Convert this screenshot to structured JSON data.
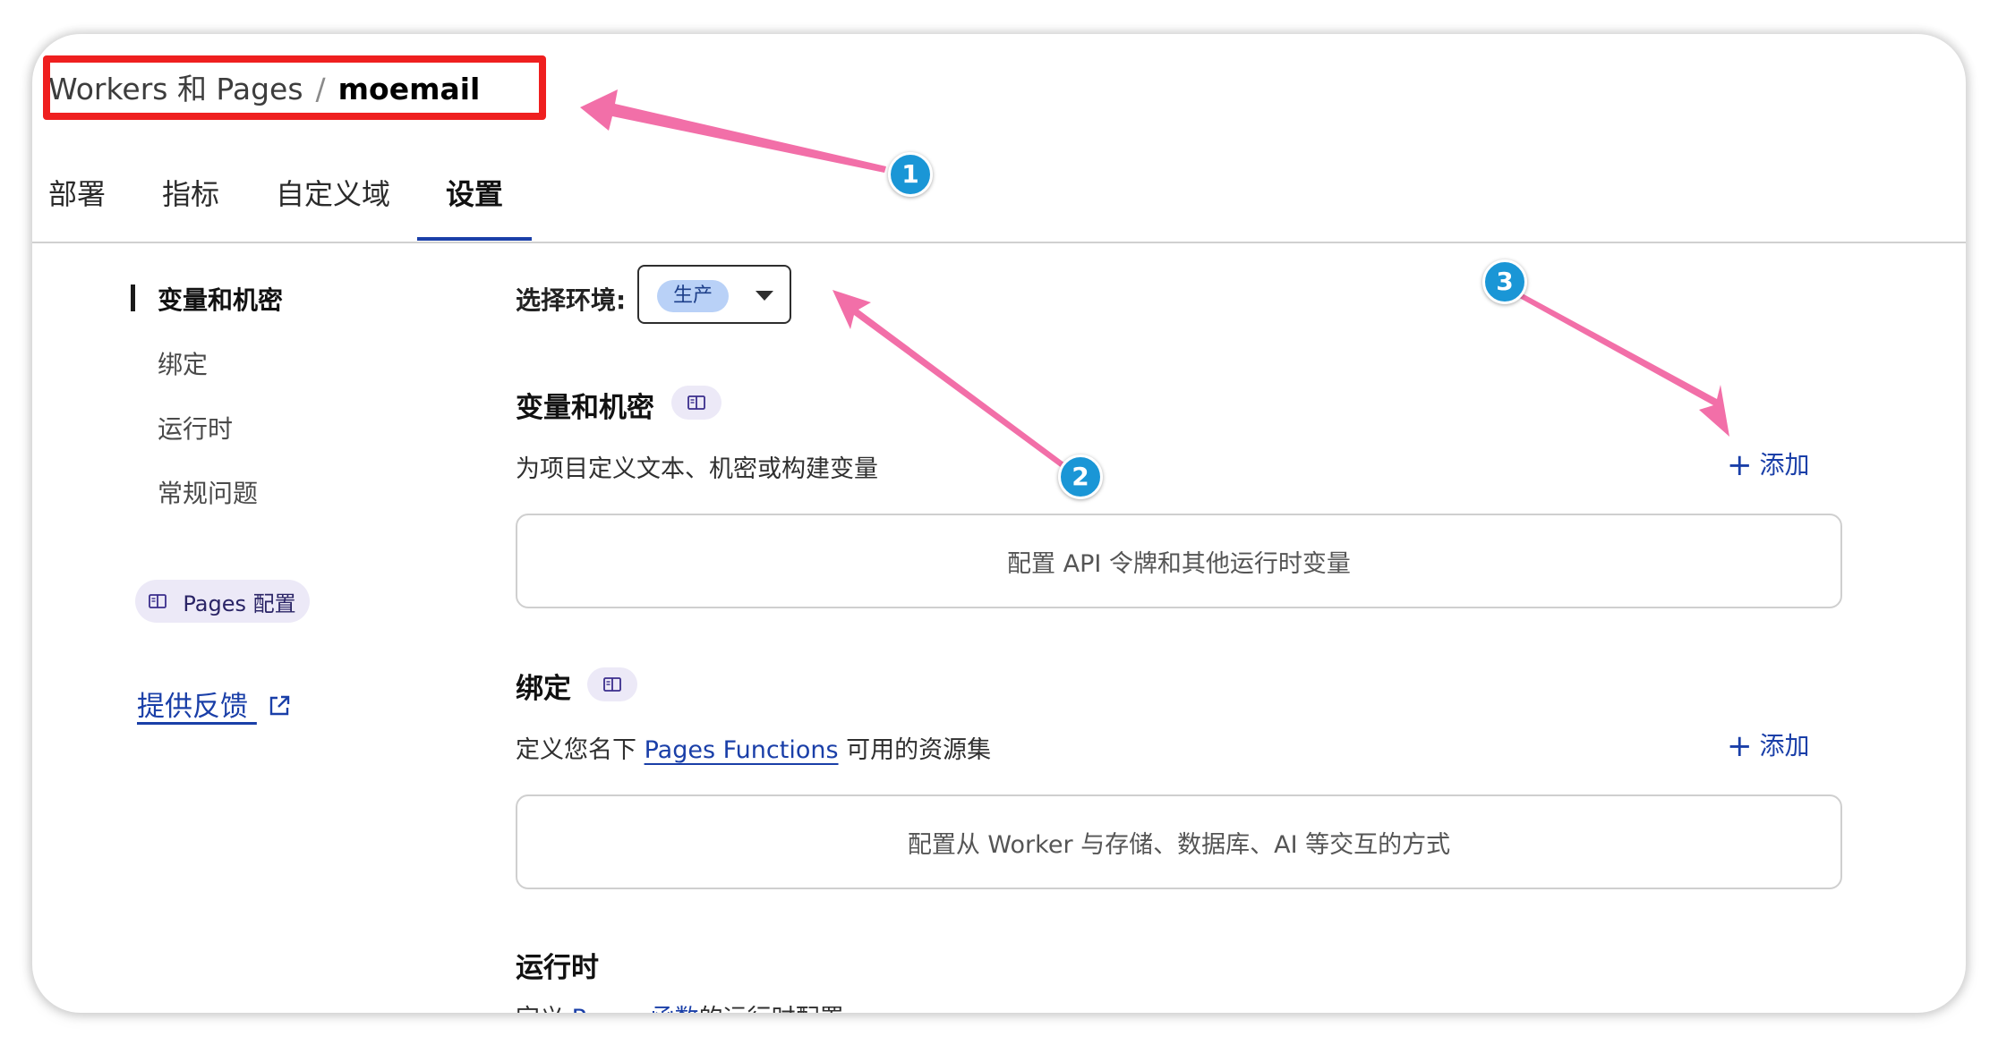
{
  "breadcrumb": {
    "parent": "Workers 和 Pages",
    "separator": "/",
    "current": "moemail"
  },
  "tabs": [
    {
      "label": "部署"
    },
    {
      "label": "指标"
    },
    {
      "label": "自定义域"
    },
    {
      "label": "设置",
      "active": true
    }
  ],
  "sidebar": {
    "items": [
      {
        "label": "变量和机密",
        "active": true
      },
      {
        "label": "绑定"
      },
      {
        "label": "运行时"
      },
      {
        "label": "常规问题"
      }
    ],
    "pages_config": "Pages 配置",
    "feedback": "提供反馈"
  },
  "environment": {
    "label": "选择环境:",
    "selected": "生产"
  },
  "sections": {
    "variables": {
      "title": "变量和机密",
      "description": "为项目定义文本、机密或构建变量",
      "add_label": "添加",
      "empty_text": "配置 API 令牌和其他运行时变量"
    },
    "bindings": {
      "title": "绑定",
      "description_prefix": "定义您名下",
      "description_link": "Pages Functions",
      "description_suffix": "可用的资源集",
      "add_label": "添加",
      "empty_text": "配置从 Worker 与存储、数据库、AI 等交互的方式"
    },
    "runtime": {
      "title": "运行时",
      "description_prefix": "定义",
      "description_link": "Pages 函数",
      "description_suffix": "的运行时配置"
    }
  },
  "annotations": {
    "callout_1": "1",
    "callout_2": "2",
    "callout_3": "3"
  },
  "colors": {
    "accent": "#1a3fa8",
    "annotation_arrow": "#f26fa8",
    "annotation_box": "#ef1f1f",
    "callout": "#1a96d6"
  }
}
